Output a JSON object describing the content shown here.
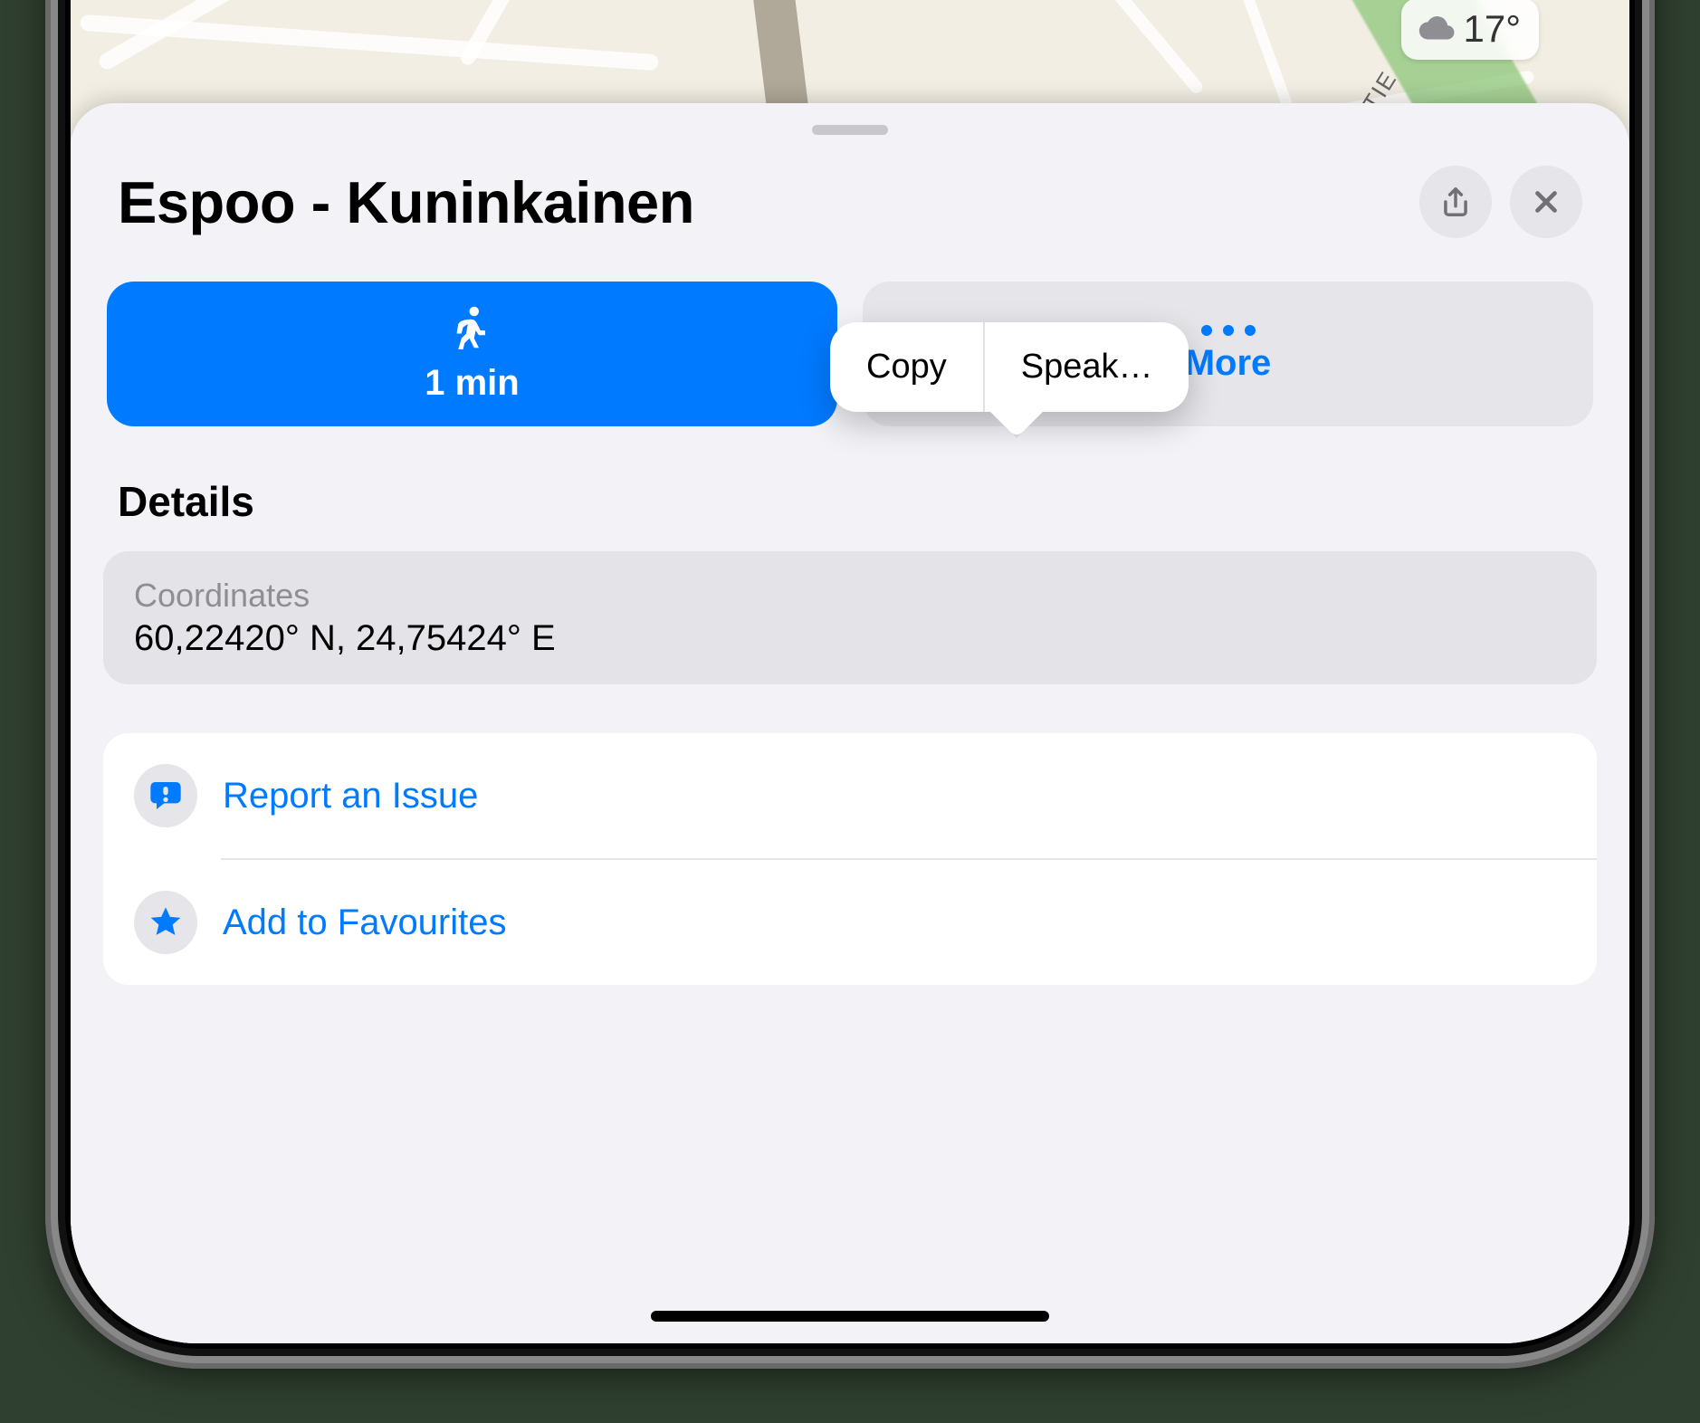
{
  "map": {
    "street_label": "AMALMINTIE",
    "weather_temp": "17°"
  },
  "sheet": {
    "title": "Espoo - Kuninkainen",
    "walk_duration": "1 min",
    "more_label": "More",
    "details_heading": "Details",
    "coordinates": {
      "label": "Coordinates",
      "value": "60,22420° N, 24,75424° E"
    },
    "actions": {
      "report": "Report an Issue",
      "favourite": "Add to Favourites"
    }
  },
  "context_menu": {
    "copy": "Copy",
    "speak": "Speak…"
  }
}
